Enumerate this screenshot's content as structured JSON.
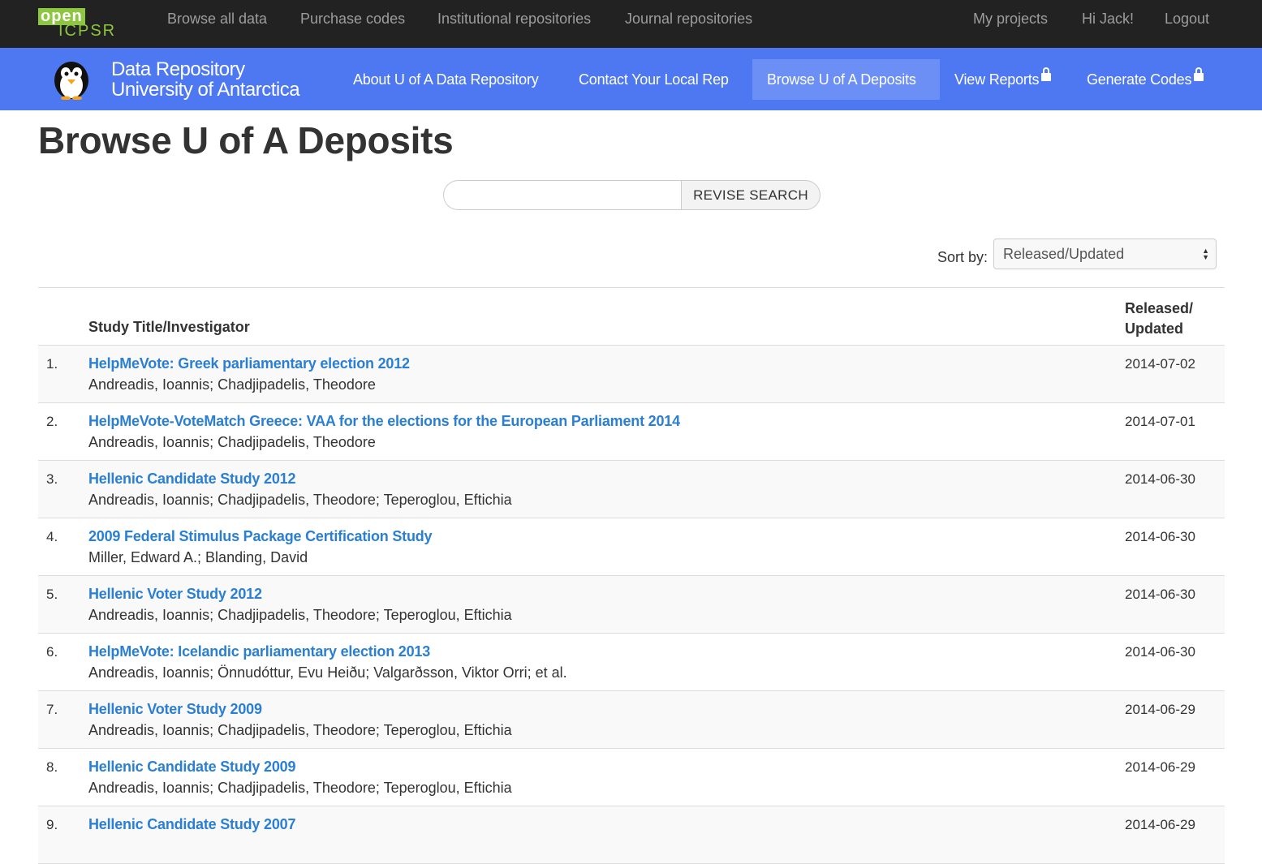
{
  "topbar": {
    "logo_top": "open",
    "logo_bottom": "ICPSR",
    "nav": [
      "Browse all data",
      "Purchase codes",
      "Institutional repositories",
      "Journal repositories"
    ],
    "right": [
      "My projects",
      "Hi Jack!",
      "Logout"
    ]
  },
  "brand": {
    "line1": "Data Repository",
    "line2": "University of Antarctica"
  },
  "bluenav": {
    "about": "About U of A Data Repository",
    "contact": "Contact Your Local Rep",
    "browse": "Browse U of A Deposits",
    "reports": "View Reports",
    "codes": "Generate Codes"
  },
  "page": {
    "title": "Browse U of A Deposits",
    "search_value": "",
    "search_button": "REVISE SEARCH",
    "sort_label": "Sort by:",
    "sort_value": "Released/Updated"
  },
  "table": {
    "col_title": "Study Title/Investigator",
    "col_date_line1": "Released/",
    "col_date_line2": "Updated",
    "rows": [
      {
        "num": "1.",
        "title": "HelpMeVote: Greek parliamentary election 2012",
        "inv": "Andreadis, Ioannis; Chadjipadelis, Theodore",
        "date": "2014-07-02"
      },
      {
        "num": "2.",
        "title": "HelpMeVote-VoteMatch Greece: VAA for the elections for the European Parliament 2014",
        "inv": "Andreadis, Ioannis; Chadjipadelis, Theodore",
        "date": "2014-07-01"
      },
      {
        "num": "3.",
        "title": "Hellenic Candidate Study 2012",
        "inv": "Andreadis, Ioannis; Chadjipadelis, Theodore; Teperoglou, Eftichia",
        "date": "2014-06-30"
      },
      {
        "num": "4.",
        "title": "2009 Federal Stimulus Package Certification Study",
        "inv": "Miller, Edward A.; Blanding, David",
        "date": "2014-06-30"
      },
      {
        "num": "5.",
        "title": "Hellenic Voter Study 2012",
        "inv": "Andreadis, Ioannis; Chadjipadelis, Theodore; Teperoglou, Eftichia",
        "date": "2014-06-30"
      },
      {
        "num": "6.",
        "title": "HelpMeVote: Icelandic parliamentary election 2013",
        "inv": "Andreadis, Ioannis; Önnudóttur, Evu Heiðu; Valgarðsson, Viktor Orri; et al.",
        "date": "2014-06-30"
      },
      {
        "num": "7.",
        "title": "Hellenic Voter Study 2009",
        "inv": "Andreadis, Ioannis; Chadjipadelis, Theodore; Teperoglou, Eftichia",
        "date": "2014-06-29"
      },
      {
        "num": "8.",
        "title": "Hellenic Candidate Study 2009",
        "inv": "Andreadis, Ioannis; Chadjipadelis, Theodore; Teperoglou, Eftichia",
        "date": "2014-06-29"
      },
      {
        "num": "9.",
        "title": "Hellenic Candidate Study 2007",
        "inv": "",
        "date": "2014-06-29"
      }
    ]
  }
}
